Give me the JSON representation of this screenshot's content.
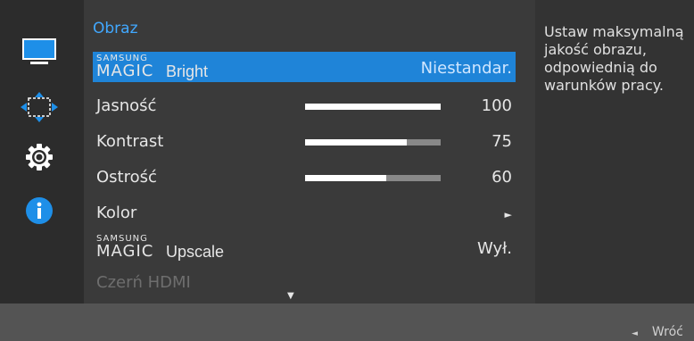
{
  "menu": {
    "title": "Obraz",
    "items": [
      {
        "kind": "magic",
        "brand_small": "SAMSUNG",
        "brand_large": "MAGIC",
        "label": "Bright",
        "value": "Niestandar.",
        "selected": true
      },
      {
        "kind": "slider",
        "label": "Jasność",
        "value": "100",
        "level": 1.0
      },
      {
        "kind": "slider",
        "label": "Kontrast",
        "value": "75",
        "level": 0.75
      },
      {
        "kind": "slider",
        "label": "Ostrość",
        "value": "60",
        "level": 0.6
      },
      {
        "kind": "submenu",
        "label": "Kolor",
        "arrow": "►"
      },
      {
        "kind": "magic",
        "brand_small": "SAMSUNG",
        "brand_large": "MAGIC",
        "label": "Upscale",
        "value": "Wył."
      },
      {
        "kind": "disabled",
        "label": "Czerń HDMI"
      }
    ],
    "scroll_arrow": "▼"
  },
  "description": "Ustaw maksymalną jakość obrazu, odpowiednią do warunków pracy.",
  "footer": {
    "back_arrow": "◄",
    "back_label": "Wróć"
  },
  "rail_icons": [
    "monitor-icon",
    "arrows-icon",
    "gear-icon",
    "info-icon"
  ],
  "colors": {
    "accent": "#1f84d8",
    "title": "#41a8ff",
    "panel": "#3a3a3a",
    "info": "#1e8fe8"
  }
}
